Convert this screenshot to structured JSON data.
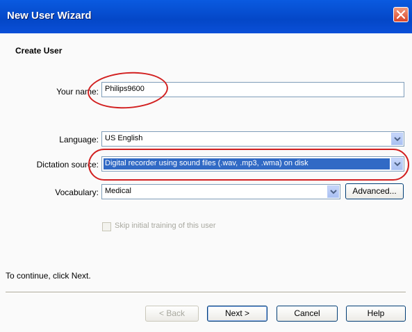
{
  "window": {
    "title": "New User Wizard"
  },
  "page": {
    "heading": "Create User",
    "name_label": "Your name:",
    "name_value": "Philips9600",
    "language_label": "Language:",
    "language_value": "US English",
    "dictation_label": "Dictation source:",
    "dictation_value": "Digital recorder using sound files (.wav, .mp3, .wma) on disk",
    "vocabulary_label": "Vocabulary:",
    "vocabulary_value": "Medical",
    "advanced_label": "Advanced...",
    "skip_training_label": "Skip initial training of this user",
    "continue_text": "To continue, click Next."
  },
  "buttons": {
    "back": "< Back",
    "next": "Next >",
    "cancel": "Cancel",
    "help": "Help"
  },
  "colors": {
    "titlebar": "#0447c7",
    "selection": "#316ac5",
    "annotation": "#d22020"
  }
}
